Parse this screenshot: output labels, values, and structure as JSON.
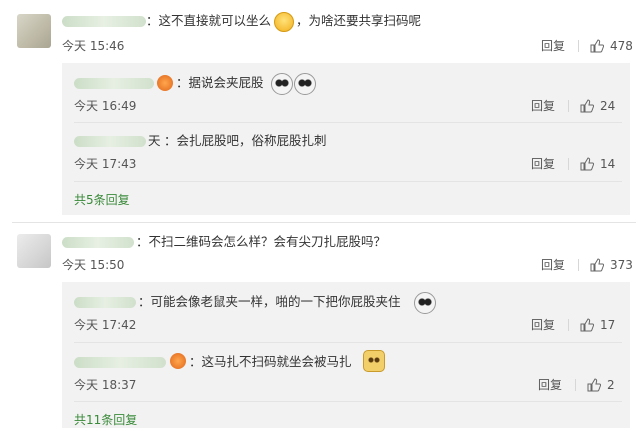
{
  "comments": [
    {
      "text": "：这不直接就可以坐么",
      "text2": "，为啥还要共享扫码呢",
      "time": "今天 15:46",
      "reply_label": "回复",
      "likes": "478",
      "replies": [
        {
          "text": "：据说会夹屁股",
          "time": "今天 16:49",
          "reply_label": "回复",
          "likes": "24"
        },
        {
          "name_tail": "天",
          "text": "：会扎屁股吧，俗称屁股扎刺",
          "time": "今天 17:43",
          "reply_label": "回复",
          "likes": "14"
        }
      ],
      "more_label": "共5条回复"
    },
    {
      "text": "：不扫二维码会怎么样？会有尖刀扎屁股吗？",
      "time": "今天 15:50",
      "reply_label": "回复",
      "likes": "373",
      "replies": [
        {
          "text": "：可能会像老鼠夹一样，啪的一下把你屁股夹住",
          "time": "今天 17:42",
          "reply_label": "回复",
          "likes": "17"
        },
        {
          "text": "：这马扎不扫码就坐会被马扎",
          "time": "今天 18:37",
          "reply_label": "回复",
          "likes": "2"
        }
      ],
      "more_label": "共11条回复"
    }
  ],
  "colors": {
    "accent_green": "#3a8a3a",
    "panel_bg": "#f2f2f2",
    "text": "#333333",
    "meta": "#555555"
  },
  "icons": {
    "like": "thumbs-up-icon",
    "emoji_laugh": "laughing-emoji-icon",
    "emoji_face": "panda-face-emoji-icon",
    "emoji_doge": "doge-emoji-icon",
    "badge": "fan-badge-icon"
  }
}
